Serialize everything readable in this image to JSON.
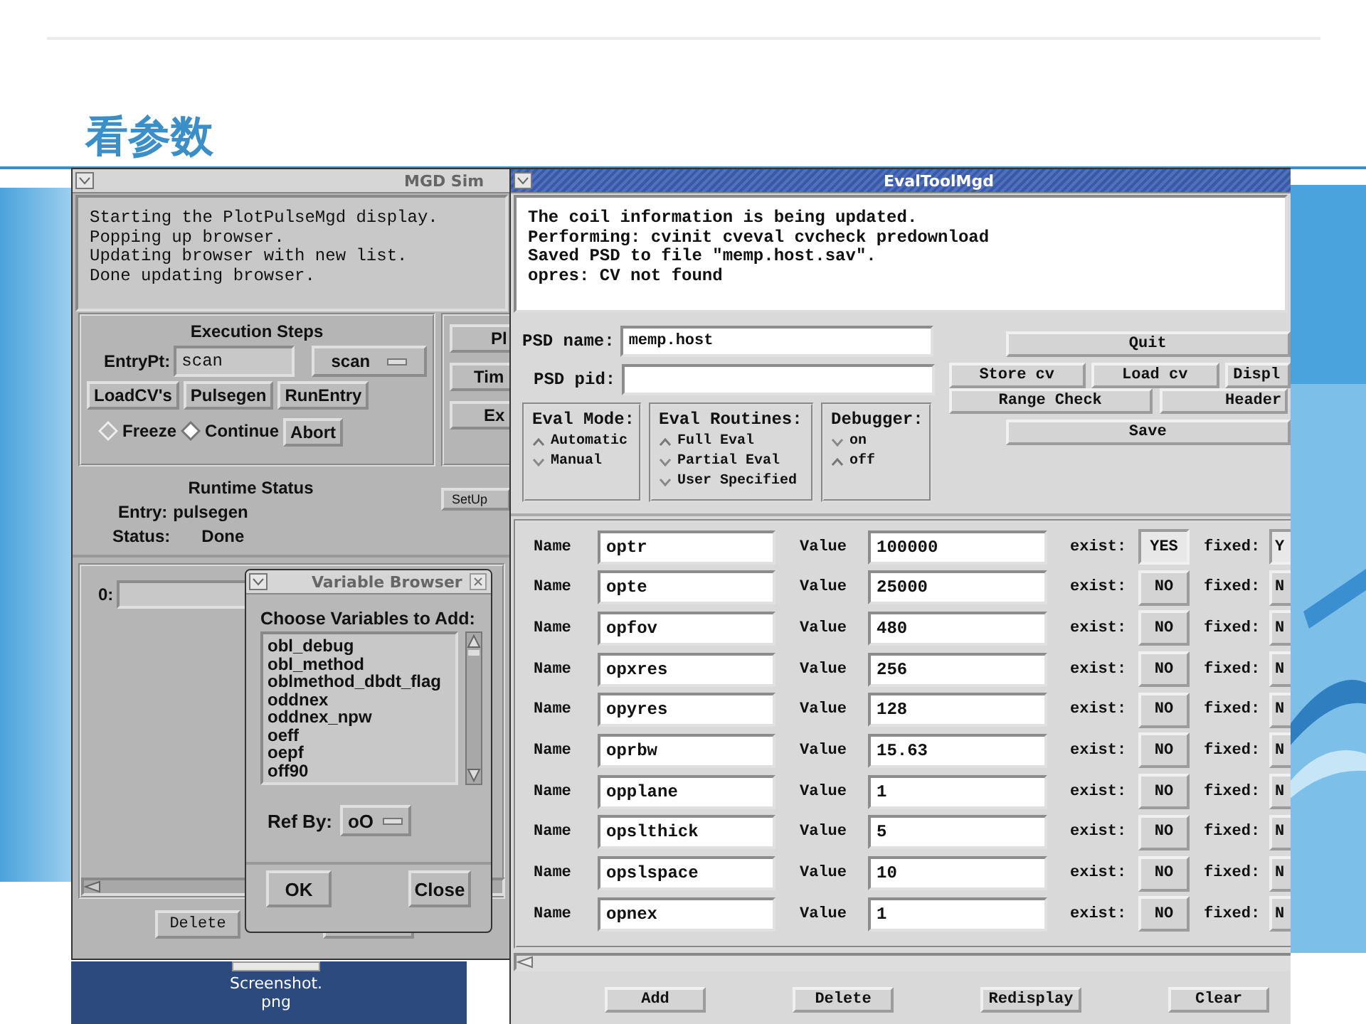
{
  "slide": {
    "title": "看参数"
  },
  "mgd_sim": {
    "title": "MGD Sim",
    "log": [
      "Starting the PlotPulseMgd display.",
      "Popping up browser.",
      "Updating browser with new list.",
      "Done updating browser."
    ],
    "execution_steps": {
      "heading": "Execution Steps",
      "entry_label": "EntryPt:",
      "entry_value": "scan",
      "entry_menu": "scan",
      "buttons": [
        "LoadCV's",
        "Pulsegen",
        "RunEntry"
      ],
      "modes": [
        {
          "label": "Freeze",
          "selected": false
        },
        {
          "label": "Continue",
          "selected": true
        }
      ],
      "abort": "Abort"
    },
    "side_buttons": [
      "Pl",
      "Tim",
      "Ex"
    ],
    "setup_button": "SetUp",
    "runtime_status": {
      "heading": "Runtime Status",
      "entry_label": "Entry:",
      "entry_value": "pulsegen",
      "status_label": "Status:",
      "status_value": "Done"
    },
    "index_label": "0:",
    "bottom_buttons": [
      "Delete"
    ]
  },
  "variable_browser": {
    "title": "Variable Browser",
    "heading": "Choose Variables to Add:",
    "items": [
      "obl_debug",
      "obl_method",
      "oblmethod_dbdt_flag",
      "oddnex",
      "oddnex_npw",
      "oeff",
      "oepf",
      "off90"
    ],
    "ref_label": "Ref By:",
    "ref_value": "oO",
    "buttons": [
      "OK",
      "Close"
    ]
  },
  "desktop_icon": {
    "label_lines": [
      "Screenshot.",
      "png"
    ]
  },
  "eval_tool": {
    "title": "EvalToolMgd",
    "log": [
      "The coil information is being updated.",
      "Performing: cvinit cveval cvcheck predownload",
      "Saved PSD to file \"memp.host.sav\".",
      "opres: CV not found"
    ],
    "psd_name_label": "PSD name:",
    "psd_name": "memp.host",
    "psd_pid_label": "PSD pid:",
    "groups": [
      {
        "title": "Eval Mode:",
        "options": [
          {
            "label": "Automatic",
            "selected": true
          },
          {
            "label": "Manual",
            "selected": false
          }
        ]
      },
      {
        "title": "Eval Routines:",
        "options": [
          {
            "label": "Full Eval",
            "selected": true
          },
          {
            "label": "Partial Eval",
            "selected": false
          },
          {
            "label": "User Specified",
            "selected": false
          }
        ]
      },
      {
        "title": "Debugger:",
        "options": [
          {
            "label": "on",
            "selected": false
          },
          {
            "label": "off",
            "selected": true
          }
        ]
      }
    ],
    "quit": "Quit",
    "store": "Store cv",
    "load": "Load cv",
    "display": "Displ",
    "range_check": "Range Check",
    "header": "Header",
    "save": "Save",
    "params": [
      {
        "name_label": "Name",
        "name": "optr",
        "value_label": "Value",
        "value": "100000",
        "exist_label": "exist:",
        "exist": "YES",
        "exist_on": true,
        "fixed_label": "fixed:",
        "fixed": "Y"
      },
      {
        "name_label": "Name",
        "name": "opte",
        "value_label": "Value",
        "value": "25000",
        "exist_label": "exist:",
        "exist": "NO",
        "exist_on": false,
        "fixed_label": "fixed:",
        "fixed": "N"
      },
      {
        "name_label": "Name",
        "name": "opfov",
        "value_label": "Value",
        "value": "480",
        "exist_label": "exist:",
        "exist": "NO",
        "exist_on": false,
        "fixed_label": "fixed:",
        "fixed": "N"
      },
      {
        "name_label": "Name",
        "name": "opxres",
        "value_label": "Value",
        "value": "256",
        "exist_label": "exist:",
        "exist": "NO",
        "exist_on": false,
        "fixed_label": "fixed:",
        "fixed": "N"
      },
      {
        "name_label": "Name",
        "name": "opyres",
        "value_label": "Value",
        "value": "128",
        "exist_label": "exist:",
        "exist": "NO",
        "exist_on": false,
        "fixed_label": "fixed:",
        "fixed": "N"
      },
      {
        "name_label": "Name",
        "name": "oprbw",
        "value_label": "Value",
        "value": "15.63",
        "exist_label": "exist:",
        "exist": "NO",
        "exist_on": false,
        "fixed_label": "fixed:",
        "fixed": "N"
      },
      {
        "name_label": "Name",
        "name": "opplane",
        "value_label": "Value",
        "value": "1",
        "exist_label": "exist:",
        "exist": "NO",
        "exist_on": false,
        "fixed_label": "fixed:",
        "fixed": "N"
      },
      {
        "name_label": "Name",
        "name": "opslthick",
        "value_label": "Value",
        "value": "5",
        "exist_label": "exist:",
        "exist": "NO",
        "exist_on": false,
        "fixed_label": "fixed:",
        "fixed": "N"
      },
      {
        "name_label": "Name",
        "name": "opslspace",
        "value_label": "Value",
        "value": "10",
        "exist_label": "exist:",
        "exist": "NO",
        "exist_on": false,
        "fixed_label": "fixed:",
        "fixed": "N"
      },
      {
        "name_label": "Name",
        "name": "opnex",
        "value_label": "Value",
        "value": "1",
        "exist_label": "exist:",
        "exist": "NO",
        "exist_on": false,
        "fixed_label": "fixed:",
        "fixed": "N"
      }
    ],
    "bottom_buttons": [
      "Add",
      "Delete",
      "Redisplay",
      "Clear"
    ]
  }
}
